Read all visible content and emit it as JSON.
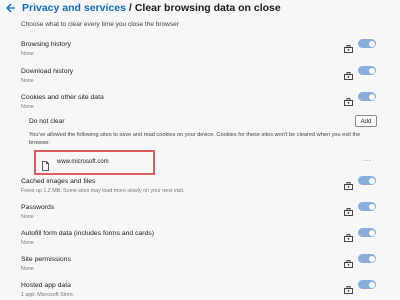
{
  "header": {
    "parent": "Privacy and services",
    "separator": "/",
    "current": "Clear browsing data on close"
  },
  "subtitle": "Choose what to clear every time you close the browser",
  "rows": [
    {
      "title": "Browsing history",
      "sub": "None"
    },
    {
      "title": "Download history",
      "sub": "None"
    },
    {
      "title": "Cookies and other site data",
      "sub": "None"
    },
    {
      "title": "Cached images and files",
      "sub": "Frees up 1.2 MB. Some sites may load more slowly on your next visit."
    },
    {
      "title": "Passwords",
      "sub": "None"
    },
    {
      "title": "Autofill form data (includes forms and cards)",
      "sub": "None"
    },
    {
      "title": "Site permissions",
      "sub": "None"
    },
    {
      "title": "Hosted app data",
      "sub": "1 app: Microsoft Store."
    }
  ],
  "do_not_clear": {
    "label": "Do not clear",
    "add_label": "Add",
    "info": "You've allowed the following sites to save and read cookies on your device. Cookies for these sites won't be cleared when you exit the browser.",
    "site": "www.microsoft.com",
    "more": "..."
  },
  "colors": {
    "accent": "#0f6cbd",
    "toggle": "#8aaedb",
    "highlight": "#e05d5d"
  }
}
